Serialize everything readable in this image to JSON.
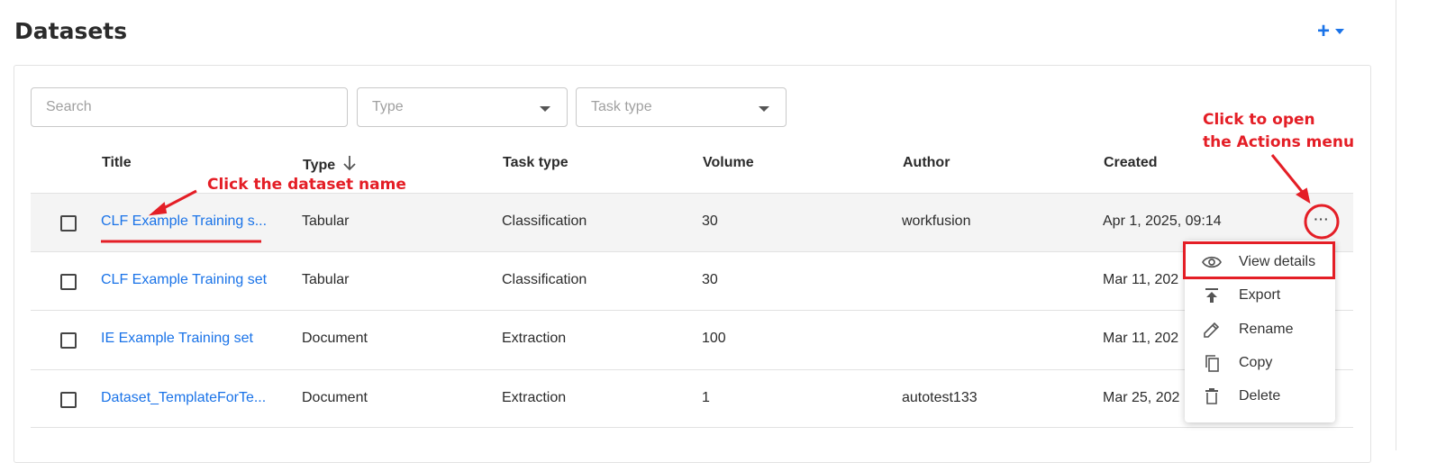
{
  "page": {
    "title": "Datasets"
  },
  "header": {
    "add_icon": "plus-icon",
    "add_caret_icon": "caret-down-icon"
  },
  "filters": {
    "search_placeholder": "Search",
    "type_placeholder": "Type",
    "task_type_placeholder": "Task type"
  },
  "table": {
    "columns": {
      "title": "Title",
      "type": "Type",
      "task_type": "Task type",
      "volume": "Volume",
      "author": "Author",
      "created": "Created"
    },
    "sort": {
      "column": "Type",
      "direction": "descending"
    },
    "rows": [
      {
        "title": "CLF Example Training s...",
        "type": "Tabular",
        "task_type": "Classification",
        "volume": "30",
        "author": "workfusion",
        "created": "Apr 1, 2025, 09:14"
      },
      {
        "title": "CLF Example Training set",
        "type": "Tabular",
        "task_type": "Classification",
        "volume": "30",
        "author": "",
        "created": "Mar 11, 202"
      },
      {
        "title": "IE Example Training set",
        "type": "Document",
        "task_type": "Extraction",
        "volume": "100",
        "author": "",
        "created": "Mar 11, 202"
      },
      {
        "title": "Dataset_TemplateForTe...",
        "type": "Document",
        "task_type": "Extraction",
        "volume": "1",
        "author": "autotest133",
        "created": "Mar 25, 202"
      }
    ]
  },
  "actions_menu": {
    "items": [
      {
        "label": "View details",
        "icon": "eye-icon"
      },
      {
        "label": "Export",
        "icon": "export-icon"
      },
      {
        "label": "Rename",
        "icon": "pencil-icon"
      },
      {
        "label": "Copy",
        "icon": "copy-icon"
      },
      {
        "label": "Delete",
        "icon": "trash-icon"
      }
    ]
  },
  "annotations": {
    "dataset_name": "Click the dataset name",
    "actions_line1": "Click to open",
    "actions_line2": "the Actions menu",
    "color": "#e41e26"
  },
  "colors": {
    "link": "#1a73e8",
    "row_highlight": "#f4f4f4",
    "accent_red": "#e41e26"
  }
}
